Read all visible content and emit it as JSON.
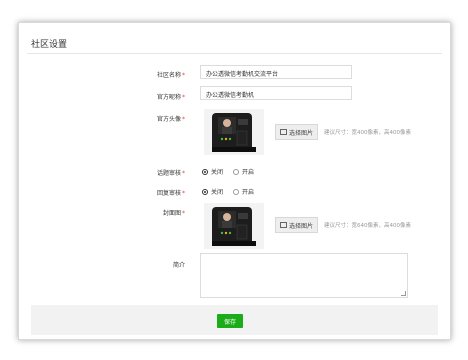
{
  "page": {
    "title": "社区设置"
  },
  "form": {
    "community_name": {
      "label": "社区名称",
      "required": "*",
      "value": "办公透微信考勤机交流平台"
    },
    "official_nickname": {
      "label": "官方昵称",
      "required": "*",
      "value": "办公透微信考勤机"
    },
    "official_avatar": {
      "label": "官方头像",
      "required": "*",
      "button": "选择图片",
      "hint": "建议尺寸：宽400像素，高400像素"
    },
    "topic_review": {
      "label": "话题审核",
      "required": "*",
      "options": [
        "关闭",
        "开启"
      ],
      "selected": "关闭"
    },
    "reply_review": {
      "label": "回复审核",
      "required": "*",
      "options": [
        "关闭",
        "开启"
      ],
      "selected": "关闭"
    },
    "cover_image": {
      "label": "封面图",
      "required": "*",
      "button": "选择图片",
      "hint": "建议尺寸：宽640像素，高400像素"
    },
    "intro": {
      "label": "简介",
      "value": ""
    }
  },
  "footer": {
    "save_label": "保存"
  },
  "colors": {
    "accent": "#1aad19",
    "required": "#e64340"
  }
}
